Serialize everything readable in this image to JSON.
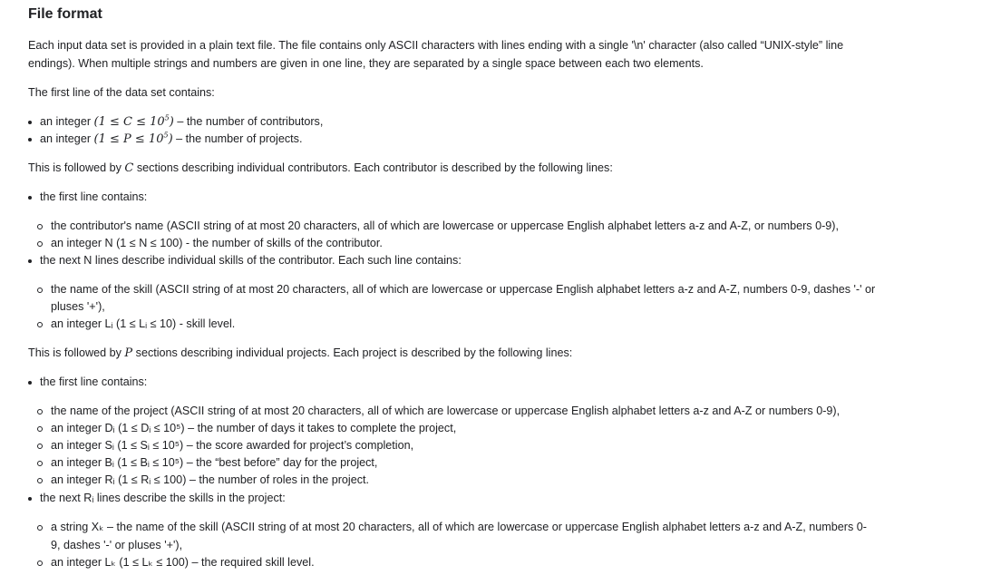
{
  "title": "File format",
  "intro_1": "Each input data set is provided in a plain text file. The file contains only ASCII characters with lines ending with a single '\\n' character (also called “UNIX-style” line",
  "intro_2": "endings). When multiple strings and numbers are given in one line, they are separated by a single space between each two elements.",
  "first_line_label": "The first line of the data set contains:",
  "first_line_items": [
    {
      "prefix": "an integer",
      "var": "C",
      "range": "(1 ≤ C ≤ 10⁵)",
      "text": "– the number of contributors,"
    },
    {
      "prefix": "an integer",
      "var": "P",
      "range": "(1 ≤ P ≤ 10⁵)",
      "text": "– the number of projects."
    }
  ],
  "contrib_intro_a": "This is followed by",
  "contrib_intro_var": "C",
  "contrib_intro_b": "sections describing individual contributors. Each contributor is described by the following lines:",
  "contrib_first_line": "the first line contains:",
  "contrib_sub": [
    "the contributor's name (ASCII string of at most 20 characters, all of which are lowercase or uppercase English alphabet letters a-z and A-Z, or numbers 0-9),",
    "an integer N (1 ≤ N ≤ 100) - the number of skills of the contributor."
  ],
  "contrib_next": "the next N lines describe individual skills of the contributor. Each such line contains:",
  "skill_sub_1a": "the name of the skill (ASCII string of at most 20 characters, all of which are lowercase or uppercase English alphabet letters a-z and A-Z, numbers 0-9, dashes '-' or",
  "skill_sub_1b": "pluses '+'),",
  "skill_sub_2": "an integer Lᵢ (1 ≤ Lᵢ ≤ 10) - skill level.",
  "proj_intro_a": "This is followed by",
  "proj_intro_var": "P",
  "proj_intro_b": "sections describing individual projects. Each project is described by the following lines:",
  "proj_first_line": "the first line contains:",
  "proj_sub": [
    "the name of the project (ASCII string of at most 20 characters, all of which are lowercase or uppercase English alphabet letters a-z and A-Z or numbers 0-9),",
    "an integer Dᵢ (1 ≤ Dᵢ ≤ 10⁵) – the number of days it takes to complete the project,",
    "an integer Sᵢ (1 ≤ Sᵢ ≤ 10⁵) – the score awarded for project’s completion,",
    "an integer Bᵢ (1 ≤ Bᵢ ≤ 10⁵) – the “best before” day for the project,",
    "an integer Rᵢ (1 ≤ Rᵢ ≤ 100) – the number of roles in the project."
  ],
  "proj_next": "the next Rᵢ lines describe the skills in the project:",
  "req_sub_1a": "a string Xₖ – the name of the skill (ASCII string of at most 20 characters, all of which are lowercase or uppercase English alphabet letters a-z and A-Z, numbers 0-",
  "req_sub_1b": "9, dashes '-' or pluses '+'),",
  "req_sub_2": "an integer Lₖ (1 ≤ Lₖ ≤ 100) – the required skill level."
}
